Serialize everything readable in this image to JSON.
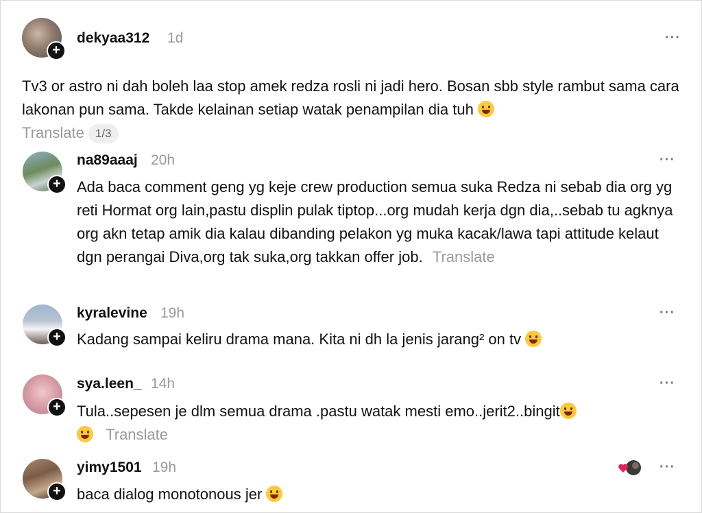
{
  "comments": [
    {
      "username": "dekyaa312",
      "time": "1d",
      "text": "Tv3 or astro ni dah boleh laa stop amek redza rosli ni jadi hero. Bosan sbb style rambut sama cara lakonan pun sama. Takde kelainan setiap watak penampilan dia tuh",
      "translate": "Translate",
      "counter": "1/3",
      "more": "···",
      "emoji": "crying-face-emoji"
    },
    {
      "username": "na89aaaj",
      "time": "20h",
      "text": "Ada baca comment geng yg keje crew production semua suka Redza ni sebab dia org yg reti Hormat org lain,pastu displin pulak tiptop...org mudah kerja dgn dia,..sebab tu agknya org akn tetap amik dia kalau dibanding pelakon yg muka kacak/lawa tapi attitude kelaut dgn perangai Diva,org tak suka,org takkan offer job.",
      "translate": "Translate",
      "more": "···"
    },
    {
      "username": "kyralevine",
      "time": "19h",
      "text": "Kadang sampai keliru drama mana. Kita ni dh la jenis jarang² on tv",
      "more": "···",
      "emoji": "laughing-emoji"
    },
    {
      "username": "sya.leen_",
      "time": "14h",
      "text": "Tula..sepesen je dlm semua drama .pastu watak mesti emo..jerit2..bingit",
      "translate": "Translate",
      "more": "···",
      "emoji": "laughing-emoji"
    },
    {
      "username": "yimy1501",
      "time": "19h",
      "text": "baca dialog monotonous jer",
      "more": "···",
      "emoji": "grinning-emoji"
    }
  ],
  "colors": {
    "muted": "#9a9a9a",
    "text": "#111111",
    "emoji": "#ffc83d",
    "heart": "#e0245e"
  }
}
